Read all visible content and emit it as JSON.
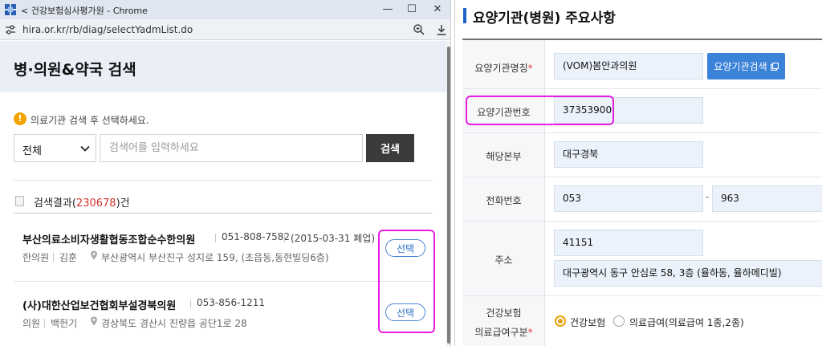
{
  "browser": {
    "window_title": "< 건강보험심사평가원 - Chrome",
    "url": "hira.or.kr/rb/diag/selectYadmList.do",
    "controls": {
      "minimize": "—",
      "maximize": "☐",
      "close": "✕"
    }
  },
  "search_page": {
    "title": "병·의원&약국 검색",
    "notice": "의료기관 검색 후 선택하세요.",
    "notice_icon": "!",
    "category_select": {
      "value": "전체"
    },
    "search_input": {
      "placeholder": "검색어를 입력하세요",
      "value": ""
    },
    "search_button": "검색",
    "result_count": {
      "prefix": "검색결과(",
      "count": "230678",
      "suffix": ")건"
    },
    "results": [
      {
        "name": "부산의료소비자생활협동조합순수한의원",
        "phone": "051-808-7582",
        "status": "(2015-03-31 폐업)",
        "type": "한의원",
        "doctor": "김훈",
        "address": "부산광역시 부산진구 성지로 159, (초읍동,동현빌딩6층)",
        "select_label": "선택"
      },
      {
        "name": "(사)대한산업보건협회부설경북의원",
        "phone": "053-856-1211",
        "status": "",
        "type": "의원",
        "doctor": "백헌기",
        "address": "경상북도 경산시 진량읍 공단1로 28",
        "select_label": "선택"
      }
    ]
  },
  "institution_form": {
    "title": "요양기관(병원) 주요사항",
    "fields": {
      "name": {
        "label": "요양기관명칭",
        "required": "*",
        "value": "(VOM)봄안과의원",
        "button": "요양기관검색"
      },
      "number": {
        "label": "요양기관번호",
        "value": "37353900"
      },
      "branch": {
        "label": "해당본부",
        "value": "대구경북"
      },
      "phone": {
        "label": "전화번호",
        "area": "053",
        "separator": "-",
        "exchange": "963"
      },
      "address": {
        "label": "주소",
        "zip": "41151",
        "line": "대구광역시 동구 안심로 58, 3층 (율하동, 율하메디빌)"
      },
      "insurance_type": {
        "label_line1": "건강보험",
        "label_line2": "의료급여구분",
        "required": "*",
        "options": [
          "건강보험",
          "의료급여(의료급여 1종,2종)"
        ],
        "selected": "건강보험"
      }
    }
  },
  "colors": {
    "accent_blue": "#3b82d9",
    "highlight_pink": "#e81ee3",
    "result_count_red": "#d2302c",
    "radio_orange": "#e8a10a"
  },
  "icons": [
    "app-icon",
    "site-settings-icon",
    "zoom-icon",
    "download-icon",
    "chevron-down-icon",
    "alert-icon",
    "list-icon",
    "location-pin-icon",
    "external-window-icon"
  ]
}
